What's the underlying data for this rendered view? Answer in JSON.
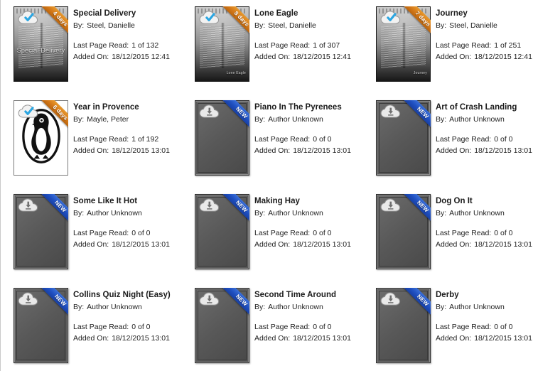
{
  "labels": {
    "by": "By:",
    "last_page_read": "Last Page Read:",
    "added_on": "Added On:"
  },
  "icons": {
    "cloud_downloaded": "cloud-check-icon",
    "cloud_download": "cloud-download-icon"
  },
  "colors": {
    "ribbon_orange": "#d4791a",
    "ribbon_blue": "#1f4fc0",
    "check_blue": "#29a3e0",
    "page_background": "#ffffff"
  },
  "books": [
    {
      "title": "Special Delivery",
      "author": "Steel, Danielle",
      "last_page_read": "1 of 132",
      "added_on": "18/12/2015 12:41",
      "ribbon": "4 days",
      "ribbon_color": "orange",
      "cover": "photo",
      "cover_title": "Special Delivery",
      "cloud_status": "downloaded"
    },
    {
      "title": "Lone Eagle",
      "author": "Steel, Danielle",
      "last_page_read": "1 of 307",
      "added_on": "18/12/2015 12:41",
      "ribbon": "8 days",
      "ribbon_color": "orange",
      "cover": "photo",
      "cover_title": "Lone Eagle",
      "cloud_status": "downloaded"
    },
    {
      "title": "Journey",
      "author": "Steel, Danielle",
      "last_page_read": "1 of 251",
      "added_on": "18/12/2015 12:41",
      "ribbon": "7 days",
      "ribbon_color": "orange",
      "cover": "photo",
      "cover_title": "Journey",
      "cloud_status": "downloaded"
    },
    {
      "title": "Year in Provence",
      "author": "Mayle, Peter",
      "last_page_read": "1 of 192",
      "added_on": "18/12/2015 13:01",
      "ribbon": "6 days",
      "ribbon_color": "orange",
      "cover": "penguin",
      "cover_title": "",
      "cloud_status": "downloaded"
    },
    {
      "title": "Piano In The Pyrenees",
      "author": "Author Unknown",
      "last_page_read": "0 of 0",
      "added_on": "18/12/2015 13:01",
      "ribbon": "NEW",
      "ribbon_color": "blue",
      "cover": "placeholder",
      "cover_title": "",
      "cloud_status": "not_downloaded"
    },
    {
      "title": "Art of Crash Landing",
      "author": "Author Unknown",
      "last_page_read": "0 of 0",
      "added_on": "18/12/2015 13:01",
      "ribbon": "NEW",
      "ribbon_color": "blue",
      "cover": "placeholder",
      "cover_title": "",
      "cloud_status": "not_downloaded"
    },
    {
      "title": "Some Like It Hot",
      "author": "Author Unknown",
      "last_page_read": "0 of 0",
      "added_on": "18/12/2015 13:01",
      "ribbon": "NEW",
      "ribbon_color": "blue",
      "cover": "placeholder",
      "cover_title": "",
      "cloud_status": "not_downloaded"
    },
    {
      "title": "Making Hay",
      "author": "Author Unknown",
      "last_page_read": "0 of 0",
      "added_on": "18/12/2015 13:01",
      "ribbon": "NEW",
      "ribbon_color": "blue",
      "cover": "placeholder",
      "cover_title": "",
      "cloud_status": "not_downloaded"
    },
    {
      "title": "Dog On It",
      "author": "Author Unknown",
      "last_page_read": "0 of 0",
      "added_on": "18/12/2015 13:01",
      "ribbon": "NEW",
      "ribbon_color": "blue",
      "cover": "placeholder",
      "cover_title": "",
      "cloud_status": "not_downloaded"
    },
    {
      "title": "Collins Quiz Night (Easy)",
      "author": "Author Unknown",
      "last_page_read": "0 of 0",
      "added_on": "18/12/2015 13:01",
      "ribbon": "NEW",
      "ribbon_color": "blue",
      "cover": "placeholder",
      "cover_title": "",
      "cloud_status": "not_downloaded"
    },
    {
      "title": "Second Time Around",
      "author": "Author Unknown",
      "last_page_read": "0 of 0",
      "added_on": "18/12/2015 13:01",
      "ribbon": "NEW",
      "ribbon_color": "blue",
      "cover": "placeholder",
      "cover_title": "",
      "cloud_status": "not_downloaded"
    },
    {
      "title": "Derby",
      "author": "Author Unknown",
      "last_page_read": "0 of 0",
      "added_on": "18/12/2015 13:01",
      "ribbon": "NEW",
      "ribbon_color": "blue",
      "cover": "placeholder",
      "cover_title": "",
      "cloud_status": "not_downloaded"
    }
  ]
}
